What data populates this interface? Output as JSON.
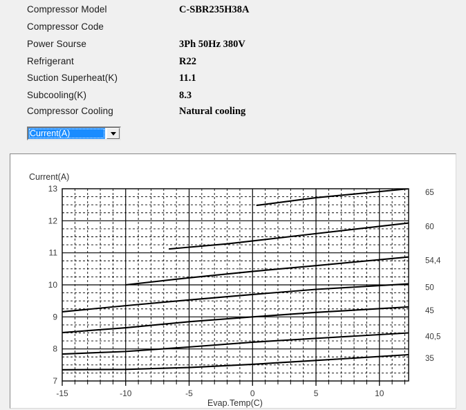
{
  "info": {
    "rows": [
      {
        "label": "Compressor  Model",
        "value": "C-SBR235H38A"
      },
      {
        "label": "Compressor Code",
        "value": ""
      },
      {
        "label": "Power Sourse",
        "value": "3Ph  50Hz  380V"
      },
      {
        "label": "Refrigerant",
        "value": "R22"
      },
      {
        "label": "Suction Superheat(K)",
        "value": "11.1"
      },
      {
        "label": "Subcooling(K)",
        "value": "8.3"
      },
      {
        "label": "Compressor Cooling",
        "value": "Natural cooling"
      }
    ]
  },
  "series_select": {
    "value": "Current(A)",
    "options": [
      "Current(A)"
    ],
    "arrow_icon": "chevron-down-icon",
    "highlight_color": "#1a8cff"
  },
  "chart_data": {
    "type": "line",
    "title": "",
    "ylabel": "Current(A)",
    "xlabel": "Evap.Temp(C)",
    "xlim": [
      -15,
      12.3
    ],
    "ylim": [
      7,
      13
    ],
    "xticks": [
      -15,
      -10,
      -5,
      0,
      5,
      10
    ],
    "xtick_labels": [
      "-15",
      "-10",
      "-5",
      "0",
      "5",
      "10"
    ],
    "yticks": [
      7,
      8,
      9,
      10,
      11,
      12,
      13
    ],
    "ytick_labels": [
      "7",
      "8",
      "9",
      "10",
      "11",
      "12",
      "13"
    ],
    "x_minor_step": 1,
    "y_minor_step": 0.25,
    "grid": "dashed-minor-solid-major",
    "legend_position": "right-of-plot",
    "legend_title": "",
    "series": [
      {
        "name": "65",
        "label": "65",
        "x": [
          0.3,
          5,
          12.3
        ],
        "y": [
          12.48,
          12.72,
          13.0
        ]
      },
      {
        "name": "60",
        "label": "60",
        "x": [
          -6.6,
          -2,
          5,
          12.3
        ],
        "y": [
          11.12,
          11.28,
          11.6,
          11.93
        ]
      },
      {
        "name": "54,4",
        "label": "54,4",
        "x": [
          -10,
          -5,
          0,
          5,
          12.3
        ],
        "y": [
          10.0,
          10.22,
          10.42,
          10.6,
          10.87
        ]
      },
      {
        "name": "50",
        "label": "50",
        "x": [
          -15,
          -10,
          -5,
          0,
          5,
          12.3
        ],
        "y": [
          9.16,
          9.35,
          9.53,
          9.7,
          9.86,
          10.03
        ]
      },
      {
        "name": "45",
        "label": "45",
        "x": [
          -15,
          -10,
          -5,
          0,
          5,
          12.3
        ],
        "y": [
          8.51,
          8.66,
          8.85,
          9.0,
          9.14,
          9.31
        ]
      },
      {
        "name": "40,5",
        "label": "40,5",
        "x": [
          -15,
          -10,
          -5,
          0,
          5,
          12.3
        ],
        "y": [
          7.84,
          7.92,
          8.06,
          8.21,
          8.33,
          8.5
        ]
      },
      {
        "name": "35",
        "label": "35",
        "x": [
          -15,
          -10,
          -5,
          0,
          5,
          12.3
        ],
        "y": [
          7.35,
          7.36,
          7.42,
          7.52,
          7.64,
          7.82
        ]
      }
    ],
    "legend_entries": [
      {
        "label": "65",
        "y_value": 13.0
      },
      {
        "label": "60",
        "y_value": 11.93
      },
      {
        "label": "54,4",
        "y_value": 10.87
      },
      {
        "label": "50",
        "y_value": 10.03
      },
      {
        "label": "45",
        "y_value": 9.31
      },
      {
        "label": "40,5",
        "y_value": 8.5
      },
      {
        "label": "35",
        "y_value": 7.82
      }
    ]
  }
}
